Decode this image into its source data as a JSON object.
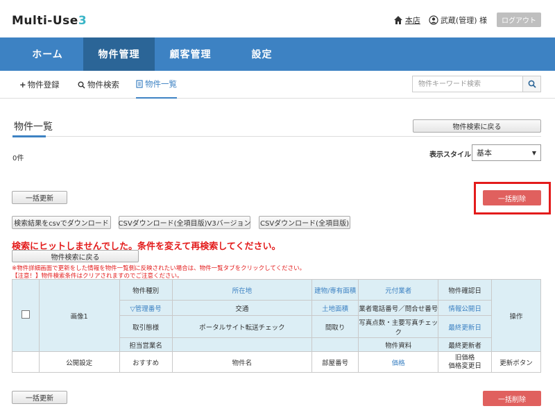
{
  "header": {
    "logo_text": "Multi-Use",
    "logo_num": "3",
    "store_link": "本店",
    "user": "武蔵(管理) 様",
    "logout": "ログアウト"
  },
  "mainnav": [
    "ホーム",
    "物件管理",
    "顧客管理",
    "設定"
  ],
  "subnav": {
    "register": "物件登録",
    "search": "物件検索",
    "list": "物件一覧",
    "keyword_placeholder": "物件キーワード検索"
  },
  "page": {
    "title": "物件一覧",
    "back_to_search": "物件検索に戻る",
    "count": "0件",
    "style_label": "表示スタイル",
    "style_value": "基本",
    "bulk_update": "一括更新",
    "bulk_delete": "一括削除",
    "csv_search": "検索結果をcsvでダウンロード",
    "csv_v3": "CSVダウンロード(全項目版)V3バージョン",
    "csv_all": "CSVダウンロード(全項目版)",
    "error": "検索にヒットしませんでした。条件を変えて再検索してください。",
    "back_btn2": "物件検索に戻る",
    "note1": "※物件詳細画面で更新をした情報を物件一覧側に反映されたい場合は、物件一覧タブをクリックしてください。",
    "note2": "【注意！】物件検索条件はクリアされますのでご注意ください。"
  },
  "table": {
    "image": "画像1",
    "row1": [
      "物件種別",
      "所在地",
      "建物/専有面積",
      "元付業者",
      "物件確認日"
    ],
    "row2": [
      "▽管理番号",
      "交通",
      "土地面積",
      "業者電話番号／問合せ番号",
      "情報公開日"
    ],
    "row3": [
      "取引態様",
      "ポータルサイト転送チェック",
      "間取り",
      "写真点数・主要写真チェック",
      "最終更新日"
    ],
    "row4": [
      "担当営業名",
      "物件資料",
      "最終更新者"
    ],
    "ops": "操作",
    "row5": [
      "公開設定",
      "おすすめ",
      "物件名",
      "部屋番号",
      "価格",
      "旧価格\n価格変更日",
      "更新ボタン"
    ]
  },
  "colors": {
    "nav": "#3d82c3",
    "nav_active": "#2b6597",
    "danger": "#e0605e",
    "header_cell": "#dceef5"
  }
}
